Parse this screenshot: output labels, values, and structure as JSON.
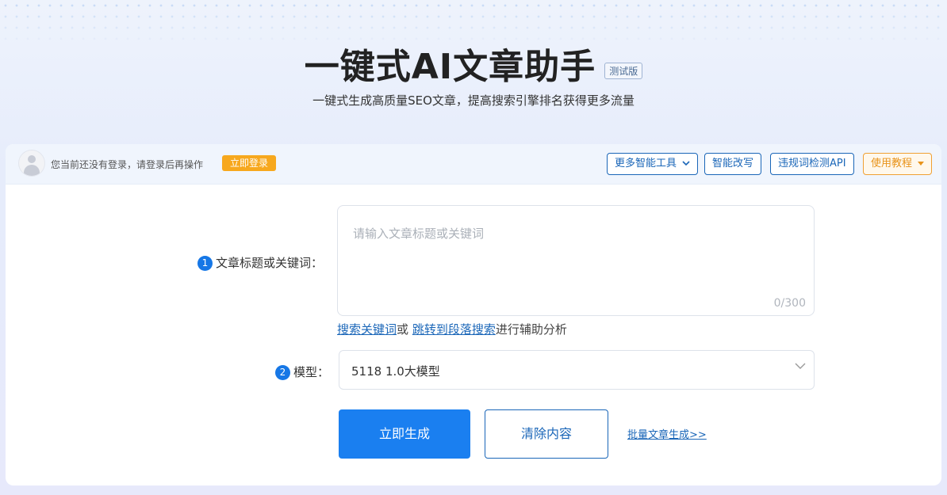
{
  "hero": {
    "title": "一键式AI文章助手",
    "badge": "测试版",
    "subtitle": "一键式生成高质量SEO文章，提高搜索引擎排名获得更多流量"
  },
  "topbar": {
    "login_notice": "您当前还没有登录，请登录后再操作",
    "login_button": "立即登录",
    "more_tools": "更多智能工具",
    "smart_rewrite": "智能改写",
    "banned_words_api": "违规词检测API",
    "tutorial": "使用教程"
  },
  "form": {
    "step1_number": "1",
    "step1_label": "文章标题或关键词：",
    "title_placeholder": "请输入文章标题或关键词",
    "char_count": "0/300",
    "helper_link1": "搜索关键词",
    "helper_or": "或",
    "helper_link2": "跳转到段落搜索",
    "helper_suffix": "进行辅助分析",
    "step2_number": "2",
    "step2_label": "模型：",
    "model_value": "5118 1.0大模型",
    "generate_button": "立即生成",
    "clear_button": "清除内容",
    "batch_link": "批量文章生成>>"
  },
  "colors": {
    "primary": "#1a7ff0",
    "link": "#1a66b8",
    "accent_orange": "#f7a81e"
  }
}
